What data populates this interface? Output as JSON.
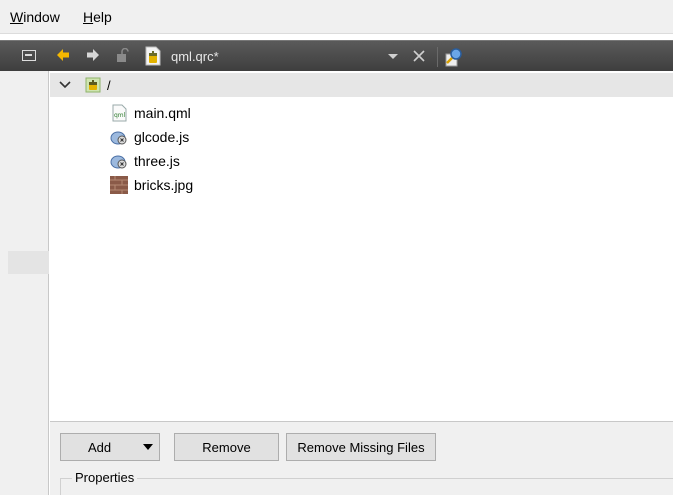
{
  "menu": {
    "window": {
      "mnemonic": "W",
      "rest": "indow"
    },
    "help": {
      "mnemonic": "H",
      "rest": "elp"
    }
  },
  "toolbar": {
    "document_title": "qml.qrc*",
    "icons": [
      "split-view-icon",
      "back-arrow-icon",
      "forward-arrow-icon",
      "unlock-icon",
      "resource-file-icon",
      "dropdown-arrow-icon",
      "close-icon",
      "locate-icon"
    ]
  },
  "tree": {
    "root_label": "/",
    "files": [
      {
        "label": "main.qml",
        "icon": "qml-file-icon"
      },
      {
        "label": "glcode.js",
        "icon": "js-file-icon"
      },
      {
        "label": "three.js",
        "icon": "js-file-icon"
      },
      {
        "label": "bricks.jpg",
        "icon": "image-file-icon"
      }
    ]
  },
  "buttons": {
    "add": "Add",
    "remove": "Remove",
    "remove_missing": "Remove Missing Files"
  },
  "properties": {
    "title": "Properties"
  },
  "colors": {
    "toolbar_bg": "#4a4a4a",
    "back_arrow": "#f5b800",
    "menubar_bg": "#f0f0f0"
  }
}
